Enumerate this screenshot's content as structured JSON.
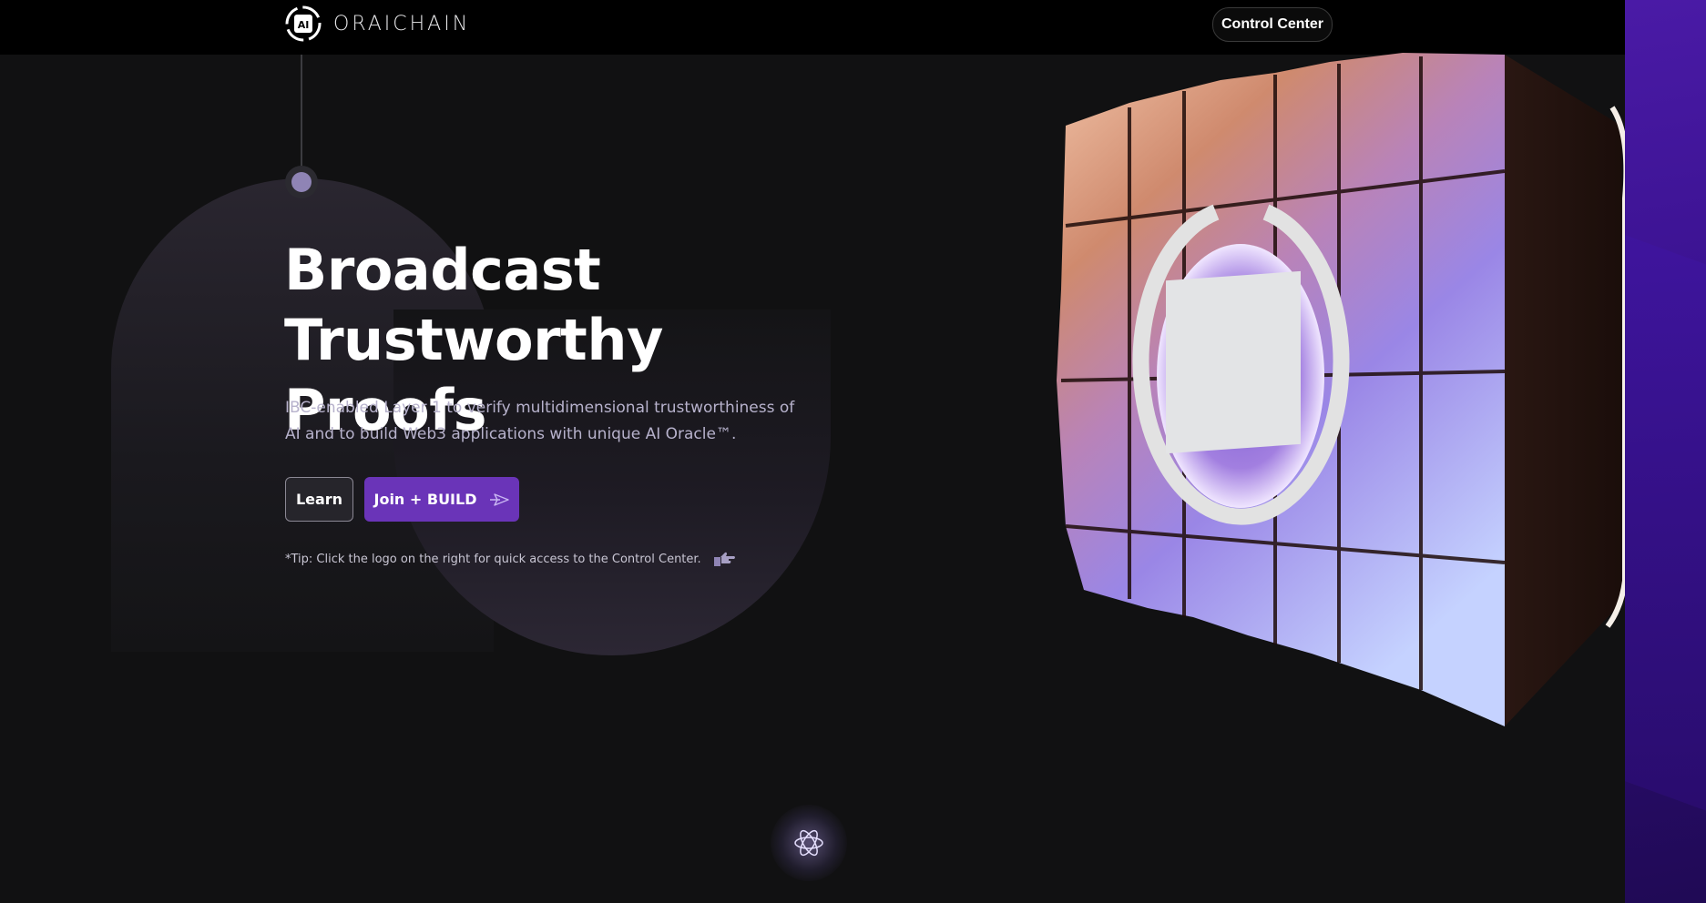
{
  "brand": {
    "name": "ORAICHAIN",
    "logo_badge": "AI"
  },
  "nav": {
    "control_center_label": "Control Center"
  },
  "hero": {
    "title_line1": "Broadcast",
    "title_line2": "Trustworthy Proofs",
    "subtitle": "IBC-enabled Layer 1 to verify multidimensional trustworthiness of AI and to build Web3 applications with unique AI Oracle™.",
    "learn_label": "Learn",
    "join_label": "Join + BUILD",
    "tip": "*Tip: Click the logo on the right for quick access to the Control Center."
  },
  "icons": {
    "logo": "oraichain-logo-icon",
    "join_arrow": "paper-plane-arrow-icon",
    "tip_hand": "pointing-hand-icon",
    "section": "atom-icon"
  },
  "colors": {
    "background": "#111112",
    "accent": "#6a34b8",
    "side_strip": "#3a1290",
    "subtitle": "#b7b2cc"
  }
}
